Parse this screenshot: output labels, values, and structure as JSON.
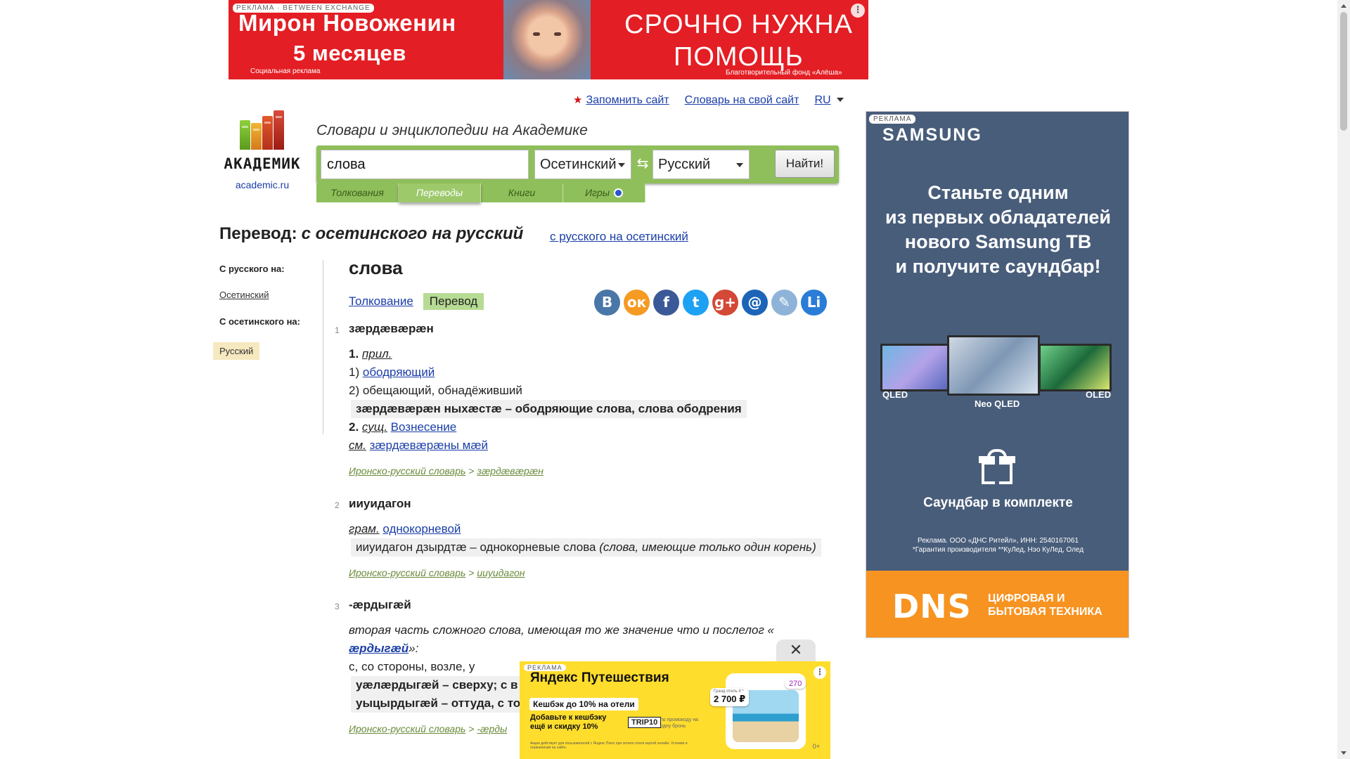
{
  "top_ad": {
    "tag": "РЕКЛАМА · BETWEEN EXCHANGE",
    "name": "Мирон Новоженин",
    "age": "5 месяцев",
    "social": "Социальная реклама",
    "urgent_line1": "СРОЧНО НУЖНА",
    "urgent_line2": "ПОМОЩЬ",
    "fund": "Благотворительный фонд «Алёша»"
  },
  "header_links": {
    "remember": "Запомнить сайт",
    "dictionary_for_site": "Словарь на свой сайт",
    "lang": "RU"
  },
  "logo": {
    "title": "АКАДЕМИК",
    "site": "academic.ru"
  },
  "search": {
    "tagline": "Словари и энциклопедии на Академике",
    "query": "слова",
    "from_lang": "Осетинский",
    "to_lang": "Русский",
    "button": "Найти!"
  },
  "tabs": [
    {
      "label": "Толкования"
    },
    {
      "label": "Переводы",
      "active": true
    },
    {
      "label": "Книги"
    },
    {
      "label": "Игры"
    }
  ],
  "heading": {
    "prefix": "Перевод:",
    "direction": "с осетинского на русский",
    "alt_direction": "с русского на осетинский"
  },
  "left_nav": {
    "from_russian_head": "С русского на:",
    "from_russian_item": "Осетинский",
    "from_ossetian_head": "С осетинского на:",
    "from_ossetian_item": "Русский"
  },
  "article": {
    "word": "слова",
    "mode_interpretation": "Толкование",
    "mode_translation": "Перевод"
  },
  "share_icons": [
    {
      "name": "vk-icon",
      "glyph": "В",
      "color": "#4a76a8"
    },
    {
      "name": "odnoklassniki-icon",
      "glyph": "ок",
      "color": "#f59a23"
    },
    {
      "name": "facebook-icon",
      "glyph": "f",
      "color": "#3b5998"
    },
    {
      "name": "twitter-icon",
      "glyph": "t",
      "color": "#1da1f2"
    },
    {
      "name": "google-plus-icon",
      "glyph": "g+",
      "color": "#d34836"
    },
    {
      "name": "mail-icon",
      "glyph": "@",
      "color": "#1c64b8"
    },
    {
      "name": "livejournal-icon",
      "glyph": "✎",
      "color": "#8fb3d8"
    },
    {
      "name": "linkedin-icon",
      "glyph": "Li",
      "color": "#2a7dd6"
    }
  ],
  "entries": [
    {
      "num": "1",
      "lemma": "зæрдæвæрæн",
      "sense1_num": "1.",
      "sense1_pos": "прил.",
      "sub1_num": "1)",
      "sub1_link": "ободряющий",
      "sub2": "2) обещающий, обнадёживший",
      "example1": "зæрдæвæрæн ныхæстæ – ободряющие слова, слова ободрения",
      "sense2_num": "2.",
      "sense2_pos": "сущ.",
      "sense2_link": "Вознесение",
      "see_label": "см.",
      "see_link": "зæрдæвæрæны мæй",
      "src_dict": "Иронско-русский словарь",
      "src_sep": " > ",
      "src_word": "зæрдæвæрæн"
    },
    {
      "num": "2",
      "lemma": "ииуидагон",
      "gram_label": "грам.",
      "gram_link": "однокорневой",
      "example_main": "ииуидагон дзырдтæ – однокорневые слова ",
      "example_note": "(слова, имеющие только один корень)",
      "src_dict": "Иронско-русский словарь",
      "src_sep": " > ",
      "src_word": "ииуидагон"
    },
    {
      "num": "3",
      "lemma": "-æрдыгæй",
      "desc": "вторая часть сложного слова, имеющая то же значение что и послелог «",
      "desc_link": "æрдыгæй",
      "desc_end": "»:",
      "meaning": "с, со стороны, возле, у",
      "example1": "уæлæрдыгæй – сверху; с в",
      "example2": "уыцырдыгæй – оттуда, с то",
      "src_dict": "Иронско-русский словарь",
      "src_sep": " > ",
      "src_word": "-æрды"
    }
  ],
  "right_ad": {
    "tag": "РЕКЛАМА",
    "brand": "SAMSUNG",
    "promo_line1": "Станьте одним",
    "promo_line2": "из первых обладателей",
    "promo_line3": "нового Samsung ТВ",
    "promo_line4": "и получите саундбар!",
    "tv_label1": "QLED",
    "tv_label2": "Neo QLED",
    "tv_label3": "OLED",
    "bonus": "Саундбар в комплекте",
    "legal1": "Реклама. ООО «ДНС Ритейл», ИНН: 2540167061",
    "legal2": "*Гарантия производителя **КуЛед, Нэо КуЛед, Олед",
    "dns_logo": "DNS",
    "dns_line1": "ЦИФРОВАЯ И",
    "dns_line2": "БЫТОВАЯ ТЕХНИКА"
  },
  "popup_ad": {
    "close": "✕",
    "tag": "РЕКЛАМА",
    "brand": "Яндекс Путешествия",
    "cashback": "Кешбэк до 10% на отели",
    "extra": "Добавьте к кешбэку ещё и скидку 10%",
    "code": "TRIP10",
    "code_note": "по промокоду на одну бронь",
    "price_small": "Гранд отель 4 *",
    "price": "2 700 ₽",
    "badge": "270",
    "age": "0+",
    "fine": "Акция действует для пользователей с Яндекс Плюс при оплате отеля картой онлайн. Условия и ограничения на сайте."
  }
}
